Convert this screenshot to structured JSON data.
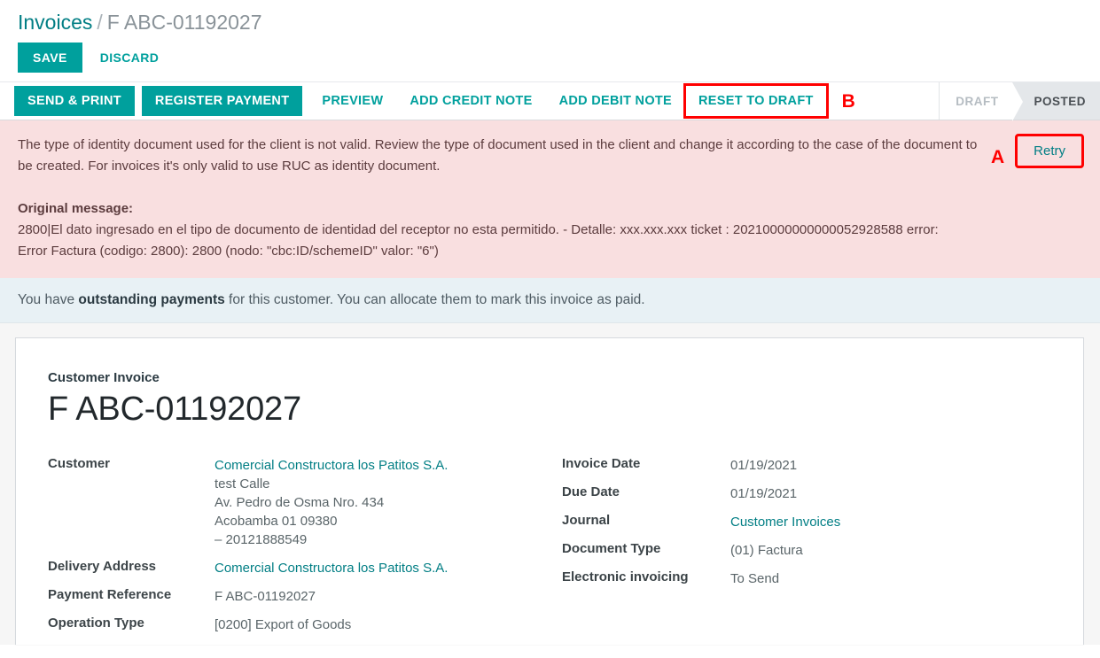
{
  "breadcrumb": {
    "root": "Invoices",
    "separator": "/",
    "current": "F ABC-01192027"
  },
  "savebar": {
    "save_label": "SAVE",
    "discard_label": "DISCARD"
  },
  "statusbar": {
    "buttons": [
      {
        "label": "SEND & PRINT",
        "style": "primary"
      },
      {
        "label": "REGISTER PAYMENT",
        "style": "primary"
      },
      {
        "label": "PREVIEW",
        "style": "link"
      },
      {
        "label": "ADD CREDIT NOTE",
        "style": "link"
      },
      {
        "label": "ADD DEBIT NOTE",
        "style": "link"
      },
      {
        "label": "RESET TO DRAFT",
        "style": "link"
      }
    ],
    "marker_b": "B",
    "pills": [
      {
        "label": "DRAFT",
        "state": "inactive"
      },
      {
        "label": "POSTED",
        "state": "active"
      }
    ]
  },
  "alert_danger": {
    "message": "The type of identity document used for the client is not valid. Review the type of document used in the client and change it according to the case of the document to be created. For invoices it's only valid to use RUC as identity document.",
    "original_label": "Original message:",
    "original_line1": "2800|El dato ingresado en el tipo de documento de identidad del receptor no esta permitido. - Detalle: xxx.xxx.xxx ticket : 20210000000000052928588 error:",
    "original_line2": "Error Factura (codigo: 2800): 2800 (nodo: \"cbc:ID/schemeID\" valor: \"6\")",
    "marker_a": "A",
    "retry_label": "Retry"
  },
  "alert_info": {
    "text_before": "You have ",
    "text_bold": "outstanding payments",
    "text_after": " for this customer. You can allocate them to mark this invoice as paid."
  },
  "sheet": {
    "subtitle": "Customer Invoice",
    "title": "F ABC-01192027",
    "left_fields": [
      {
        "label": "Customer",
        "value_lines": [
          {
            "text": "Comercial Constructora los Patitos S.A.",
            "link": true
          },
          {
            "text": "test Calle",
            "link": false
          },
          {
            "text": "Av. Pedro de Osma Nro. 434",
            "link": false
          },
          {
            "text": "Acobamba 01 09380",
            "link": false
          },
          {
            "text": "– 20121888549",
            "link": false
          }
        ]
      },
      {
        "label": "Delivery Address",
        "value_lines": [
          {
            "text": "Comercial Constructora los Patitos S.A.",
            "link": true
          }
        ]
      },
      {
        "label": "Payment Reference",
        "value_lines": [
          {
            "text": "F ABC-01192027",
            "link": false
          }
        ]
      },
      {
        "label": "Operation Type",
        "value_lines": [
          {
            "text": "[0200] Export of Goods",
            "link": false
          }
        ]
      }
    ],
    "right_fields": [
      {
        "label": "Invoice Date",
        "value": "01/19/2021",
        "link": false
      },
      {
        "label": "Due Date",
        "value": "01/19/2021",
        "link": false
      },
      {
        "label": "Journal",
        "value": "Customer Invoices",
        "link": true
      },
      {
        "label": "Document Type",
        "value": "(01) Factura",
        "link": false
      },
      {
        "label": "Electronic invoicing",
        "value": "To Send",
        "link": false
      }
    ]
  },
  "colors": {
    "accent": "#00a09d",
    "link": "#017e84",
    "danger_bg": "#f9dfe0",
    "info_bg": "#e8f1f5",
    "marker": "#ff0000"
  }
}
